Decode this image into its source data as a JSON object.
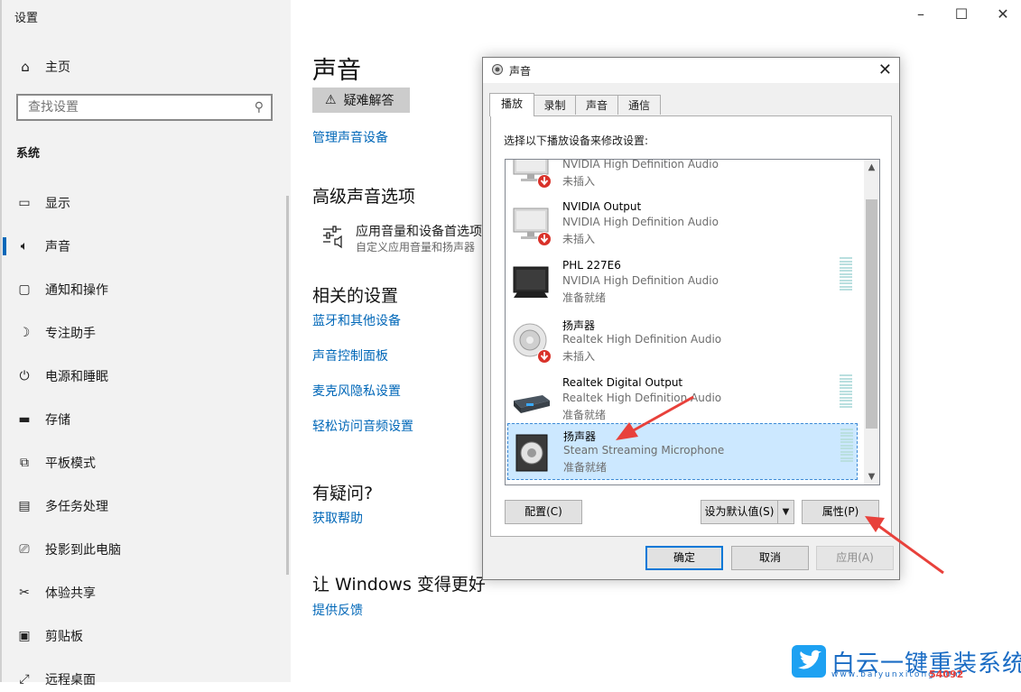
{
  "settings": {
    "title": "设置",
    "home": "主页",
    "search_placeholder": "查找设置",
    "section": "系统",
    "nav": [
      {
        "label": "显示",
        "icon": "monitor-icon"
      },
      {
        "label": "声音",
        "icon": "speaker-icon",
        "active": true
      },
      {
        "label": "通知和操作",
        "icon": "notification-icon"
      },
      {
        "label": "专注助手",
        "icon": "moon-icon"
      },
      {
        "label": "电源和睡眠",
        "icon": "power-icon"
      },
      {
        "label": "存储",
        "icon": "storage-icon"
      },
      {
        "label": "平板模式",
        "icon": "tablet-icon"
      },
      {
        "label": "多任务处理",
        "icon": "multitask-icon"
      },
      {
        "label": "投影到此电脑",
        "icon": "project-icon"
      },
      {
        "label": "体验共享",
        "icon": "share-icon"
      },
      {
        "label": "剪贴板",
        "icon": "clipboard-icon"
      },
      {
        "label": "远程桌面",
        "icon": "remote-icon"
      }
    ],
    "main": {
      "title": "声音",
      "troubleshoot": "疑难解答",
      "manage_devices": "管理声音设备",
      "advanced_heading": "高级声音选项",
      "advanced_title": "应用音量和设备首选项",
      "advanced_sub": "自定义应用音量和扬声器",
      "related_heading": "相关的设置",
      "related_links": [
        "蓝牙和其他设备",
        "声音控制面板",
        "麦克风隐私设置",
        "轻松访问音频设置"
      ],
      "question_heading": "有疑问?",
      "help_link": "获取帮助",
      "better_heading": "让 Windows 变得更好",
      "feedback_link": "提供反馈"
    }
  },
  "dialog": {
    "title": "声音",
    "tabs": [
      "播放",
      "录制",
      "声音",
      "通信"
    ],
    "instruction": "选择以下播放设备来修改设置:",
    "devices": [
      {
        "name": "",
        "desc": "NVIDIA High Definition Audio",
        "status": "未插入",
        "type": "monitor-gray",
        "unplugged": true
      },
      {
        "name": "NVIDIA Output",
        "desc": "NVIDIA High Definition Audio",
        "status": "未插入",
        "type": "monitor-gray",
        "unplugged": true
      },
      {
        "name": "PHL 227E6",
        "desc": "NVIDIA High Definition Audio",
        "status": "准备就绪",
        "type": "monitor-dark",
        "meter": true
      },
      {
        "name": "扬声器",
        "desc": "Realtek High Definition Audio",
        "status": "未插入",
        "type": "speaker",
        "unplugged": true
      },
      {
        "name": "Realtek Digital Output",
        "desc": "Realtek High Definition Audio",
        "status": "准备就绪",
        "type": "digital",
        "meter": true
      },
      {
        "name": "扬声器",
        "desc": "Steam Streaming Microphone",
        "status": "准备就绪",
        "type": "speaker-box",
        "meter": true,
        "selected": true
      }
    ],
    "configure": "配置(C)",
    "set_default": "设为默认值(S)",
    "properties": "属性(P)",
    "ok": "确定",
    "cancel": "取消",
    "apply": "应用(A)"
  },
  "watermark": {
    "text": "白云一键重装系统",
    "sub": "www.baiyunxitong.com",
    "code": "54092"
  },
  "colors": {
    "accent": "#0067b8",
    "selection": "#cce8ff",
    "annotation_arrow": "#e8413b"
  }
}
